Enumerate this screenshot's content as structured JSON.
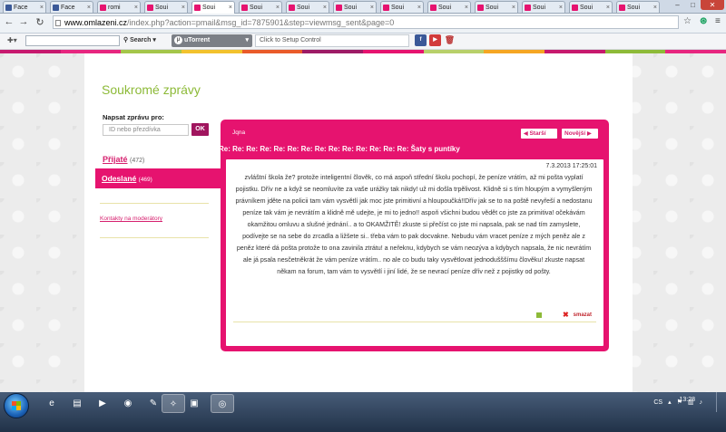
{
  "browser": {
    "tabs": [
      {
        "label": "Face",
        "icon": "facebook-icon",
        "color": "#3b5998"
      },
      {
        "label": "Face",
        "icon": "facebook-icon",
        "color": "#3b5998"
      },
      {
        "label": "romi",
        "icon": "omlazeni-favicon",
        "color": "#e6136f"
      },
      {
        "label": "Soui",
        "icon": "omlazeni-favicon",
        "color": "#e6136f"
      },
      {
        "label": "Soui",
        "icon": "omlazeni-favicon",
        "color": "#e6136f",
        "active": true
      },
      {
        "label": "Soui",
        "icon": "omlazeni-favicon",
        "color": "#e6136f"
      },
      {
        "label": "Soui",
        "icon": "omlazeni-favicon",
        "color": "#e6136f"
      },
      {
        "label": "Soui",
        "icon": "omlazeni-favicon",
        "color": "#e6136f"
      },
      {
        "label": "Soui",
        "icon": "omlazeni-favicon",
        "color": "#e6136f"
      },
      {
        "label": "Soui",
        "icon": "omlazeni-favicon",
        "color": "#e6136f"
      },
      {
        "label": "Soui",
        "icon": "omlazeni-favicon",
        "color": "#e6136f"
      },
      {
        "label": "Soui",
        "icon": "omlazeni-favicon",
        "color": "#e6136f"
      },
      {
        "label": "Soui",
        "icon": "omlazeni-favicon",
        "color": "#e6136f"
      },
      {
        "label": "Soui",
        "icon": "omlazeni-favicon",
        "color": "#e6136f"
      }
    ],
    "url_host": "www.omlazeni.cz",
    "url_rest": "/index.php?action=pmail&msg_id=7875901&step=viewmsg_sent&page=0"
  },
  "toolbar": {
    "search_label": "Search",
    "utorrent_label": "uTorrent",
    "setup_text": "Click to Setup Control"
  },
  "accent": "#e6136f",
  "strip_colors": [
    "#c7196e",
    "#e7267f",
    "#a4c64a",
    "#f2c22e",
    "#e95b2a",
    "#9d1b66",
    "#e6136f",
    "#b8d06a",
    "#f5a623",
    "#c7196e",
    "#8dba38",
    "#e7267f"
  ],
  "page": {
    "heading": "Soukromé zprávy",
    "compose_label": "Napsat zprávu pro:",
    "compose_placeholder": "ID nebo přezdívka",
    "ok_label": "OK",
    "folders": [
      {
        "name": "Přijaté",
        "count": "(472)"
      },
      {
        "name": "Odeslané",
        "count": "(469)"
      }
    ],
    "contact_link": "Kontakty na moderátory"
  },
  "message": {
    "sender": "Jqna",
    "prev_label": "Starší",
    "next_label": "Novější",
    "subject": "Re: Re: Re: Re: Re: Re: Re: Re: Re: Re: Re: Re: Re: Re: Šaty s puntíky",
    "date": "7.3.2013 17:25:01",
    "body": "zvláštní škola že? protože inteligentní člověk, co má aspoň střední školu pochopí, že peníze vrátím, až mi pošta vyplatí pojistku. Dřív ne a když se neomluvíte za vaše urážky tak nikdy! už mi došla trpělivost. Klidně si s tím hloupým a vymyšleným právníkem jděte na policii tam vám vysvětlí jak moc jste primitivní a hloupoučká!!Dřív jak se to na poště nevyřeší a nedostanu peníze tak vám je nevrátím a klidně mě udejte, je mi to jedno!! aspoň všichni budou vědět co jste za primitiva! očekávám okamžitou omluvu a slušné jednání.. a to OKAMŽITĚ! zkuste si přečíst co jste mi napsala, pak se nad tím zamyslete, podívejte se na sebe do zrcadla a ližšete si.. třeba vám to pak docvakne. Nebudu vám vracet peníze z mých peněz ale z peněz které dá pošta protože to ona zavinila ztrátu! a neřeknu, kdybych se vám neozýva a kdybych napsala, že nic nevrátím ale já psala nesčetněkrát že vám peníze vrátím.. no ale co budu taky vysvětlovat jednodušššímu člověku! zkuste napsat někam na forum, tam vám to vysvětlí i jiní lidé, že se nevrací peníze dřív než z pojistky od pošty.",
    "delete_label": "smazat"
  },
  "taskbar": {
    "language": "CS",
    "time": "13:28"
  }
}
